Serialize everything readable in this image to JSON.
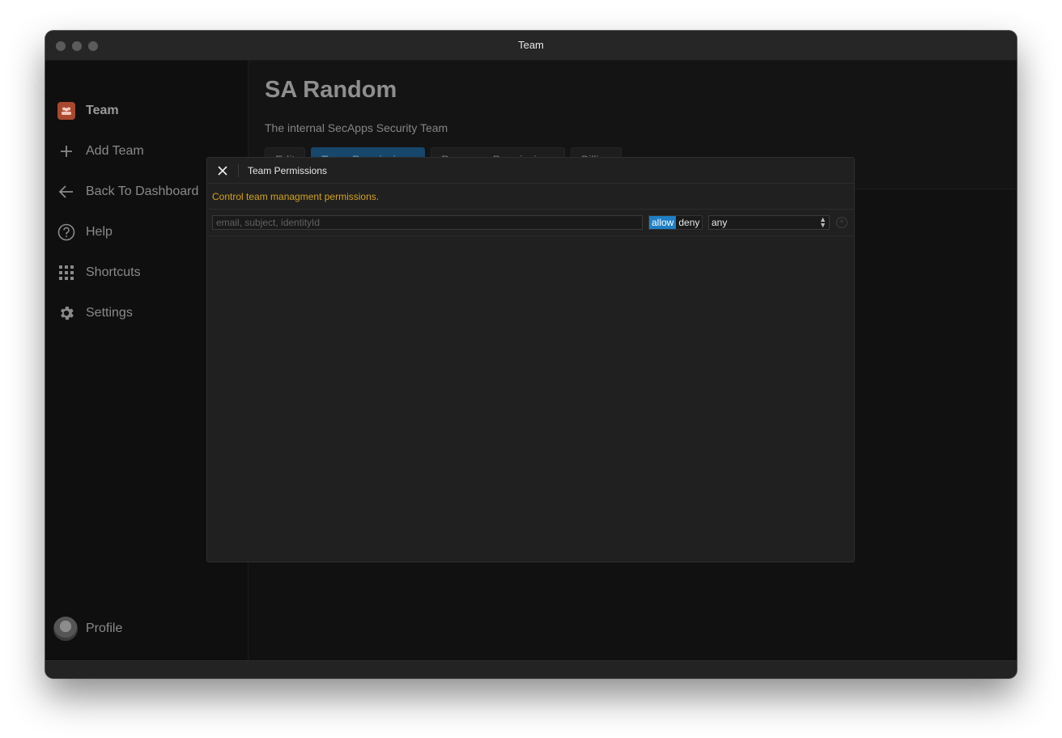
{
  "window": {
    "title": "Team"
  },
  "sidebar": {
    "brand": "Team",
    "items": [
      {
        "label": "Add Team",
        "icon": "plus-icon"
      },
      {
        "label": "Back To Dashboard",
        "icon": "arrow-left-icon"
      },
      {
        "label": "Help",
        "icon": "help-icon"
      },
      {
        "label": "Shortcuts",
        "icon": "grid-icon"
      },
      {
        "label": "Settings",
        "icon": "gear-icon"
      }
    ],
    "profile": "Profile"
  },
  "main": {
    "title": "SA Random",
    "subtitle": "The internal SecApps Security Team",
    "tabs": [
      "Edit",
      "Team Permissions",
      "Resource Permissions",
      "Billing"
    ],
    "active_tab": "Team Permissions"
  },
  "modal": {
    "title": "Team Permissions",
    "description": "Control team managment permissions.",
    "search_placeholder": "email, subject, identityId",
    "effect_options": [
      "allow",
      "deny"
    ],
    "effect_selected": "allow",
    "scope_value": "any"
  },
  "colors": {
    "accent": "#1e7fc6",
    "warning_text": "#d3a21c",
    "brand": "#a8482e"
  }
}
